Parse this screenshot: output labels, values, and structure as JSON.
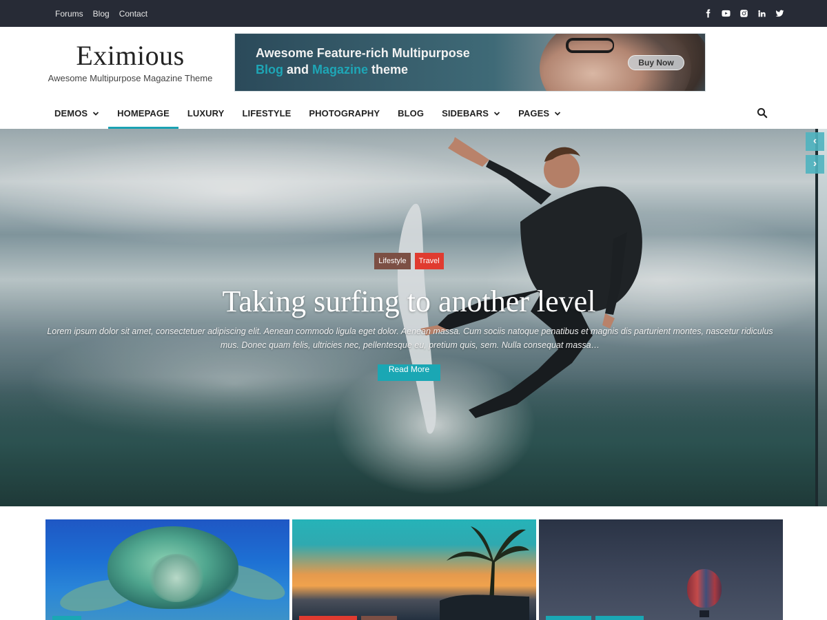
{
  "topbar": {
    "links": [
      "Forums",
      "Blog",
      "Contact"
    ],
    "social_icons": [
      "facebook-icon",
      "youtube-icon",
      "instagram-icon",
      "linkedin-icon",
      "twitter-icon"
    ]
  },
  "brand": {
    "title": "Eximious",
    "tagline": "Awesome Multipurpose Magazine Theme"
  },
  "ad": {
    "line1": "Awesome Feature-rich Multipurpose",
    "line2_part1": "Blog",
    "line2_part2": " and ",
    "line2_part3": "Magazine",
    "line2_part4": " theme",
    "button": "Buy Now"
  },
  "nav": {
    "items": [
      {
        "label": "DEMOS",
        "dropdown": true
      },
      {
        "label": "HOMEPAGE",
        "dropdown": false,
        "active": true
      },
      {
        "label": "LUXURY",
        "dropdown": false
      },
      {
        "label": "LIFESTYLE",
        "dropdown": false
      },
      {
        "label": "PHOTOGRAPHY",
        "dropdown": false
      },
      {
        "label": "BLOG",
        "dropdown": false
      },
      {
        "label": "SIDEBARS",
        "dropdown": true
      },
      {
        "label": "PAGES",
        "dropdown": true
      }
    ]
  },
  "hero": {
    "categories": [
      "Lifestyle",
      "Travel"
    ],
    "title": "Taking surfing to another level",
    "excerpt": "Lorem ipsum dolor sit amet, consectetuer adipiscing elit. Aenean commodo ligula eget dolor. Aenean massa. Cum sociis natoque penatibus et magnis dis parturient montes, nascetur ridiculus mus. Donec quam felis, ultricies nec, pellentesque eu, pretium quis, sem. Nulla consequat massa…",
    "button": "Read More",
    "prev_arrow": "‹",
    "next_arrow": "›"
  },
  "colors": {
    "accent": "#1aa2b3",
    "topbar": "#272b36",
    "category_lifestyle": "#7c4f44",
    "category_travel": "#e03b30"
  }
}
